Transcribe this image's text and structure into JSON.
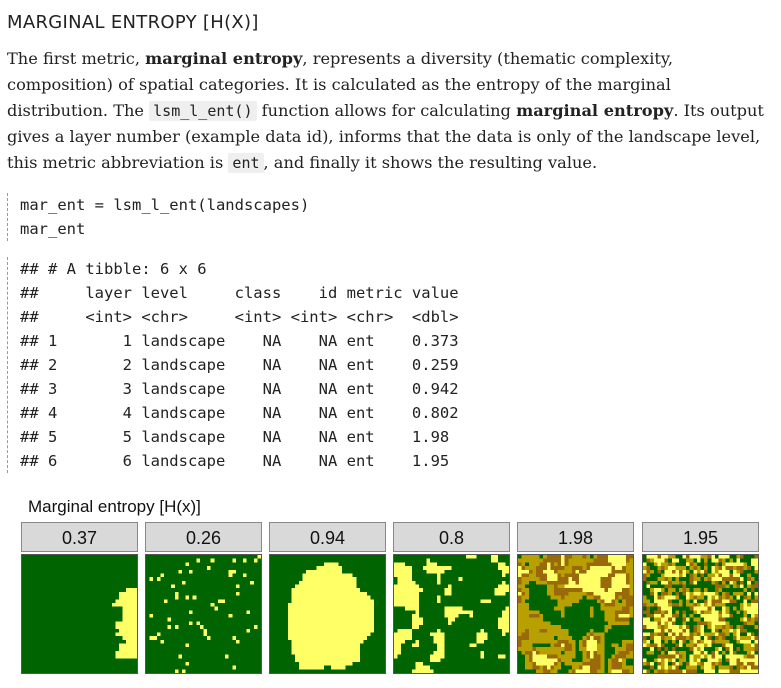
{
  "section": {
    "heading": "MARGINAL ENTROPY [H(X)]",
    "p1_a": "The first metric, ",
    "p1_bold1": "marginal entropy",
    "p1_b": ", represents a diversity (thematic complexity, composition) of spatial categories. It is calculated as the entropy of the marginal distribution. The ",
    "p1_code1": "lsm_l_ent()",
    "p1_c": " function allows for calculating ",
    "p1_bold2": "marginal entropy",
    "p1_d": ". Its output gives a layer number (example data id), informs that the data is only of the landscape level, this metric abbreviation is ",
    "p1_code2": "ent",
    "p1_e": ", and finally it shows the resulting value."
  },
  "code_source": "mar_ent = lsm_l_ent(landscapes)\nmar_ent",
  "code_output": "## # A tibble: 6 x 6\n##     layer level     class    id metric value\n##     <int> <chr>     <int> <int> <chr>  <dbl>\n## 1       1 landscape    NA    NA ent    0.373\n## 2       2 landscape    NA    NA ent    0.259\n## 3       3 landscape    NA    NA ent    0.942\n## 4       4 landscape    NA    NA ent    0.802\n## 5       5 landscape    NA    NA ent    1.98 \n## 6       6 landscape    NA    NA ent    1.95 ",
  "figure": {
    "title": "Marginal entropy [H(x)]",
    "panels": [
      {
        "label": "0.37"
      },
      {
        "label": "0.26"
      },
      {
        "label": "0.94"
      },
      {
        "label": "0.8"
      },
      {
        "label": "1.98"
      },
      {
        "label": "1.95"
      }
    ],
    "colors": {
      "forest": "#006400",
      "yellow": "#ffff66",
      "olive": "#b8a000",
      "brown": "#9a6a0a",
      "strip_bg": "#d9d9d9"
    }
  }
}
